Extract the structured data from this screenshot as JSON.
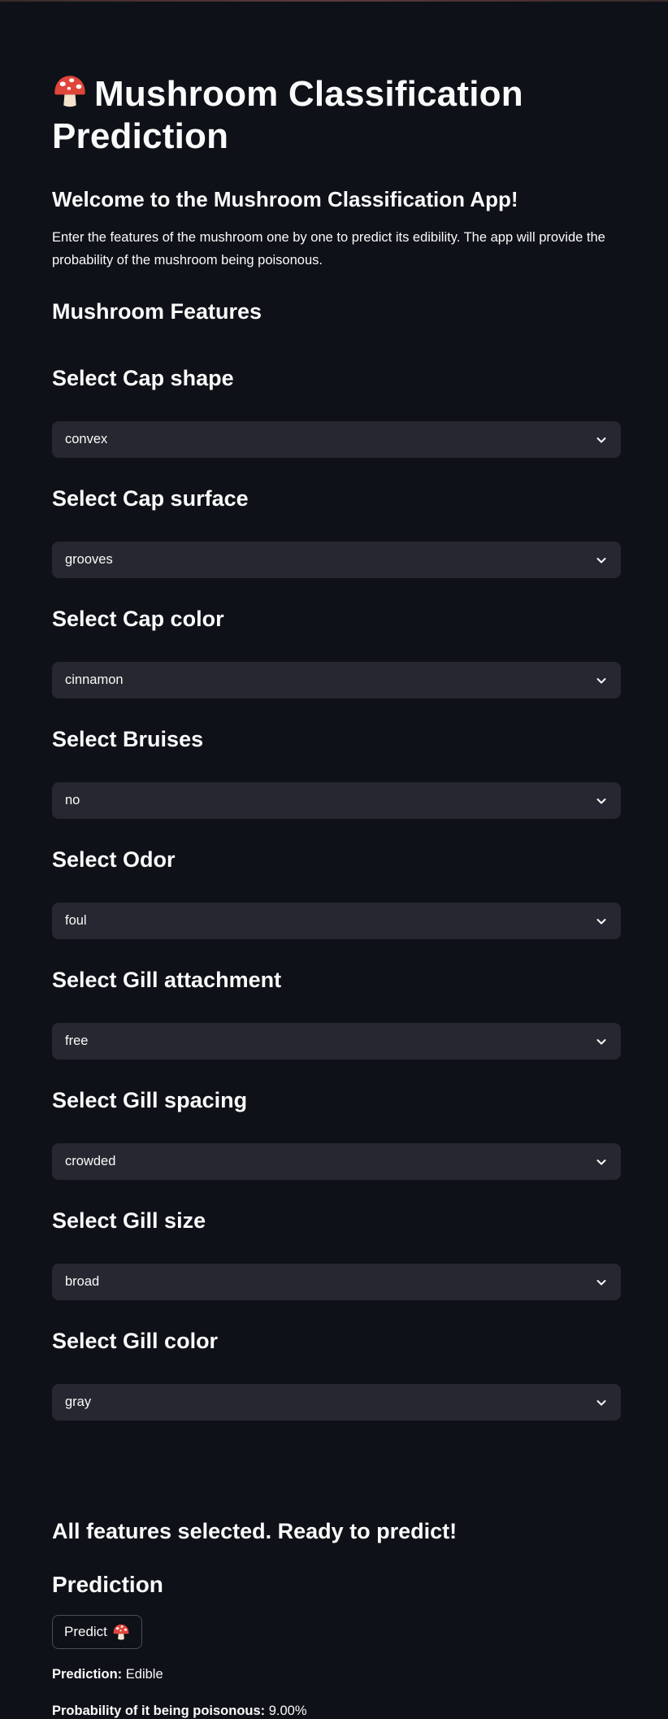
{
  "app": {
    "title": "Mushroom Classification Prediction",
    "title_icon": "mushroom-icon",
    "subtitle": "Welcome to the Mushroom Classification App!",
    "intro": "Enter the features of the mushroom one by one to predict its edibility. The app will provide the probability of the mushroom being poisonous."
  },
  "features": {
    "heading": "Mushroom Features",
    "items": [
      {
        "label": "Select Cap shape",
        "value": "convex"
      },
      {
        "label": "Select Cap surface",
        "value": "grooves"
      },
      {
        "label": "Select Cap color",
        "value": "cinnamon"
      },
      {
        "label": "Select Bruises",
        "value": "no"
      },
      {
        "label": "Select Odor",
        "value": "foul"
      },
      {
        "label": "Select Gill attachment",
        "value": "free"
      },
      {
        "label": "Select Gill spacing",
        "value": "crowded"
      },
      {
        "label": "Select Gill size",
        "value": "broad"
      },
      {
        "label": "Select Gill color",
        "value": "gray"
      }
    ]
  },
  "status": {
    "ready": "All features selected. Ready to predict!"
  },
  "prediction": {
    "heading": "Prediction",
    "button_label": "Predict",
    "button_icon": "mushroom-icon",
    "result_label": "Prediction:",
    "result_value": "Edible",
    "probability_label": "Probability of it being poisonous:",
    "probability_value": "9.00%"
  },
  "colors": {
    "background": "#0e1117",
    "select_background": "#262730",
    "text": "#fafafa",
    "mushroom_cap": "#e0453a"
  }
}
